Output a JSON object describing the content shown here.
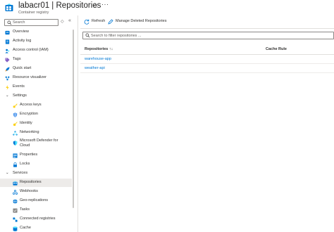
{
  "header": {
    "title": "labacr01 | Repositories",
    "subtitle": "Container registry",
    "star": "☆",
    "more": "···"
  },
  "sidebar": {
    "search_placeholder": "Search",
    "collapse": "◇",
    "chevron": "«",
    "items": [
      {
        "label": "Overview",
        "icon": "overview-icon"
      },
      {
        "label": "Activity log",
        "icon": "activity-log-icon"
      },
      {
        "label": "Access control (IAM)",
        "icon": "iam-icon"
      },
      {
        "label": "Tags",
        "icon": "tag-icon"
      },
      {
        "label": "Quick start",
        "icon": "rocket-icon"
      },
      {
        "label": "Resource visualizer",
        "icon": "visualizer-icon"
      },
      {
        "label": "Events",
        "icon": "lightning-icon"
      },
      {
        "label": "Settings",
        "group": true
      },
      {
        "label": "Access keys",
        "icon": "key-icon"
      },
      {
        "label": "Encryption",
        "icon": "shield-icon"
      },
      {
        "label": "Identity",
        "icon": "identity-icon"
      },
      {
        "label": "Networking",
        "icon": "network-icon"
      },
      {
        "label": "Microsoft Defender for Cloud",
        "icon": "defender-icon",
        "line1": "Microsoft Defender for",
        "line2": "Cloud"
      },
      {
        "label": "Properties",
        "icon": "properties-icon"
      },
      {
        "label": "Locks",
        "icon": "lock-icon"
      },
      {
        "label": "Services",
        "group": true
      },
      {
        "label": "Repositories",
        "icon": "repositories-icon",
        "selected": true
      },
      {
        "label": "Webhooks",
        "icon": "webhook-icon"
      },
      {
        "label": "Geo-replications",
        "icon": "globe-icon"
      },
      {
        "label": "Tasks",
        "icon": "tasks-icon"
      },
      {
        "label": "Connected registries",
        "icon": "connected-registry-icon"
      },
      {
        "label": "Cache",
        "icon": "cache-icon"
      }
    ]
  },
  "toolbar": {
    "refresh_label": "Refresh",
    "manage_deleted_label": "Manage Deleted Repositories"
  },
  "filter": {
    "placeholder": "Search to filter repositories ..."
  },
  "table": {
    "columns": [
      "Repositories ↑↓",
      "Cache Rule"
    ],
    "rows": [
      {
        "repository": "warehouse-app",
        "cache_rule": ""
      },
      {
        "repository": "weather-api",
        "cache_rule": ""
      }
    ]
  },
  "colors": {
    "accent": "#0078d4",
    "selected_bg": "#edebe9",
    "border": "#8a8886"
  }
}
